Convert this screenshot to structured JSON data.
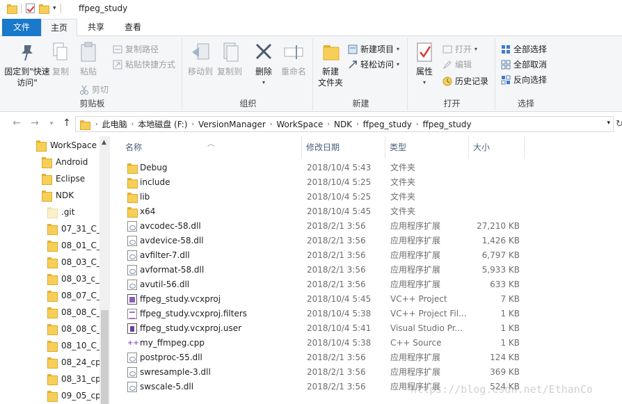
{
  "window": {
    "title": "ffpeg_study"
  },
  "ribbon_tabs": {
    "file": "文件",
    "home": "主页",
    "share": "共享",
    "view": "查看"
  },
  "clipboard": {
    "pin": "固定到\"快速访问\"",
    "copy": "复制",
    "paste": "粘贴",
    "copy_path": "复制路径",
    "paste_shortcut": "粘贴快捷方式",
    "cut": "剪切",
    "label": "剪贴板"
  },
  "organize": {
    "move_to": "移动到",
    "copy_to": "复制到",
    "delete": "删除",
    "rename": "重命名",
    "label": "组织"
  },
  "new_group": {
    "new_folder": "新建\n文件夹",
    "new_item": "新建项目",
    "easy_access": "轻松访问",
    "label": "新建"
  },
  "open_group": {
    "properties": "属性",
    "open": "打开",
    "edit": "编辑",
    "history": "历史记录",
    "label": "打开"
  },
  "select_group": {
    "select_all": "全部选择",
    "select_none": "全部取消",
    "invert": "反向选择",
    "label": "选择"
  },
  "address": {
    "crumbs": [
      "此电脑",
      "本地磁盘 (F:)",
      "VersionManager",
      "WorkSpace",
      "NDK",
      "ffpeg_study",
      "ffpeg_study"
    ]
  },
  "nav_tree": [
    {
      "label": "WorkSpace",
      "pale": false
    },
    {
      "label": "Android",
      "pale": false
    },
    {
      "label": "Eclipse",
      "pale": false
    },
    {
      "label": "NDK",
      "pale": false
    },
    {
      "label": ".git",
      "pale": true
    },
    {
      "label": "07_31_C_(",
      "pale": false
    },
    {
      "label": "08_01_C_(",
      "pale": false
    },
    {
      "label": "08_03_C_(",
      "pale": false
    },
    {
      "label": "08_03_c_(",
      "pale": false
    },
    {
      "label": "08_07_C_(",
      "pale": false
    },
    {
      "label": "08_08_C_(",
      "pale": false
    },
    {
      "label": "08_08_C_(",
      "pale": false
    },
    {
      "label": "08_10_C_(",
      "pale": false
    },
    {
      "label": "08_24_cpp",
      "pale": false
    },
    {
      "label": "08_31_cpp",
      "pale": false
    },
    {
      "label": "09_05_cpp",
      "pale": false
    }
  ],
  "columns": {
    "name": "名称",
    "date": "修改日期",
    "type": "类型",
    "size": "大小"
  },
  "files": [
    {
      "name": "Debug",
      "date": "2018/10/4 5:43",
      "type": "文件夹",
      "size": "",
      "icon": "folder-icon"
    },
    {
      "name": "include",
      "date": "2018/10/4 5:25",
      "type": "文件夹",
      "size": "",
      "icon": "folder-icon"
    },
    {
      "name": "lib",
      "date": "2018/10/4 5:25",
      "type": "文件夹",
      "size": "",
      "icon": "folder-icon"
    },
    {
      "name": "x64",
      "date": "2018/10/4 5:45",
      "type": "文件夹",
      "size": "",
      "icon": "folder-icon"
    },
    {
      "name": "avcodec-58.dll",
      "date": "2018/2/1 3:56",
      "type": "应用程序扩展",
      "size": "27,210 KB",
      "icon": "dll-icon"
    },
    {
      "name": "avdevice-58.dll",
      "date": "2018/2/1 3:56",
      "type": "应用程序扩展",
      "size": "1,426 KB",
      "icon": "dll-icon"
    },
    {
      "name": "avfilter-7.dll",
      "date": "2018/2/1 3:56",
      "type": "应用程序扩展",
      "size": "6,797 KB",
      "icon": "dll-icon"
    },
    {
      "name": "avformat-58.dll",
      "date": "2018/2/1 3:56",
      "type": "应用程序扩展",
      "size": "5,933 KB",
      "icon": "dll-icon"
    },
    {
      "name": "avutil-56.dll",
      "date": "2018/2/1 3:56",
      "type": "应用程序扩展",
      "size": "633 KB",
      "icon": "dll-icon"
    },
    {
      "name": "ffpeg_study.vcxproj",
      "date": "2018/10/4 5:45",
      "type": "VC++ Project",
      "size": "7 KB",
      "icon": "vcxproj-icon"
    },
    {
      "name": "ffpeg_study.vcxproj.filters",
      "date": "2018/10/4 5:38",
      "type": "VC++ Project Fil...",
      "size": "1 KB",
      "icon": "filters-icon"
    },
    {
      "name": "ffpeg_study.vcxproj.user",
      "date": "2018/10/4 5:41",
      "type": "Visual Studio Pr...",
      "size": "1 KB",
      "icon": "user-icon"
    },
    {
      "name": "my_ffmpeg.cpp",
      "date": "2018/10/4 5:38",
      "type": "C++ Source",
      "size": "1 KB",
      "icon": "cpp-icon"
    },
    {
      "name": "postproc-55.dll",
      "date": "2018/2/1 3:56",
      "type": "应用程序扩展",
      "size": "124 KB",
      "icon": "dll-icon"
    },
    {
      "name": "swresample-3.dll",
      "date": "2018/2/1 3:56",
      "type": "应用程序扩展",
      "size": "369 KB",
      "icon": "dll-icon"
    },
    {
      "name": "swscale-5.dll",
      "date": "2018/2/1 3:56",
      "type": "应用程序扩展",
      "size": "524 KB",
      "icon": "dll-icon"
    }
  ],
  "watermark": "https://blog.csdn.net/EthanCo",
  "colors": {
    "accent": "#1979ca",
    "folder": "#f7cf58"
  }
}
